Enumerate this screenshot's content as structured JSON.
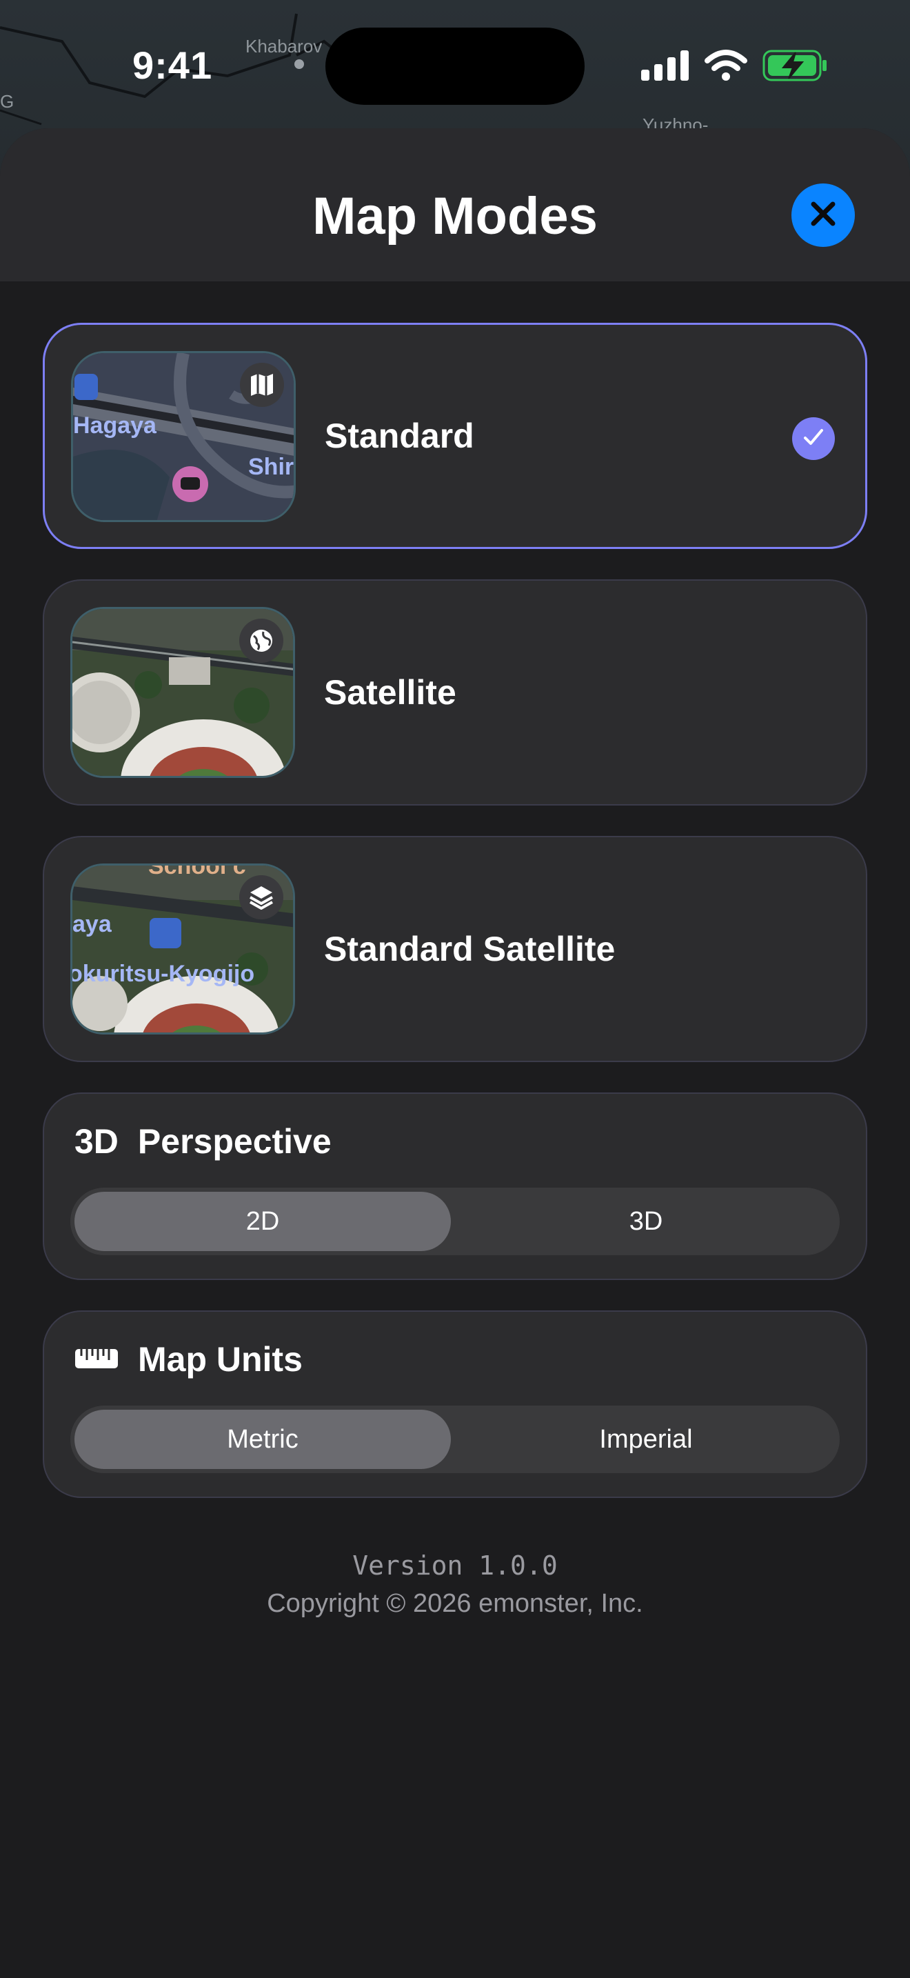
{
  "status_bar": {
    "time": "9:41",
    "icons": [
      "signal-icon",
      "wifi-icon",
      "battery-charging-icon"
    ],
    "battery_color": "#34c759"
  },
  "background_map": {
    "labels": [
      "Khabarov",
      "Yuzhno-",
      "G"
    ]
  },
  "sheet": {
    "title": "Map Modes",
    "close_icon": "close-icon",
    "accent": "#0a84ff"
  },
  "map_modes": [
    {
      "label": "Standard",
      "selected": true,
      "badge_icon": "map-icon",
      "thumb_labels": [
        "Hagaya",
        "Shir"
      ]
    },
    {
      "label": "Satellite",
      "selected": false,
      "badge_icon": "globe-icon",
      "thumb_labels": []
    },
    {
      "label": "Standard Satellite",
      "selected": false,
      "badge_icon": "layers-icon",
      "thumb_labels": [
        "aya",
        "okuritsu-Kyogijo",
        "School c"
      ]
    }
  ],
  "selection_color": "#7d7ff5",
  "perspective": {
    "lead": "3D",
    "title": "Perspective",
    "options": [
      "2D",
      "3D"
    ],
    "selected": "2D"
  },
  "units": {
    "icon": "ruler-icon",
    "title": "Map Units",
    "options": [
      "Metric",
      "Imperial"
    ],
    "selected": "Metric"
  },
  "footer": {
    "version": "Version 1.0.0",
    "copyright": "Copyright © 2026 emonster, Inc."
  }
}
